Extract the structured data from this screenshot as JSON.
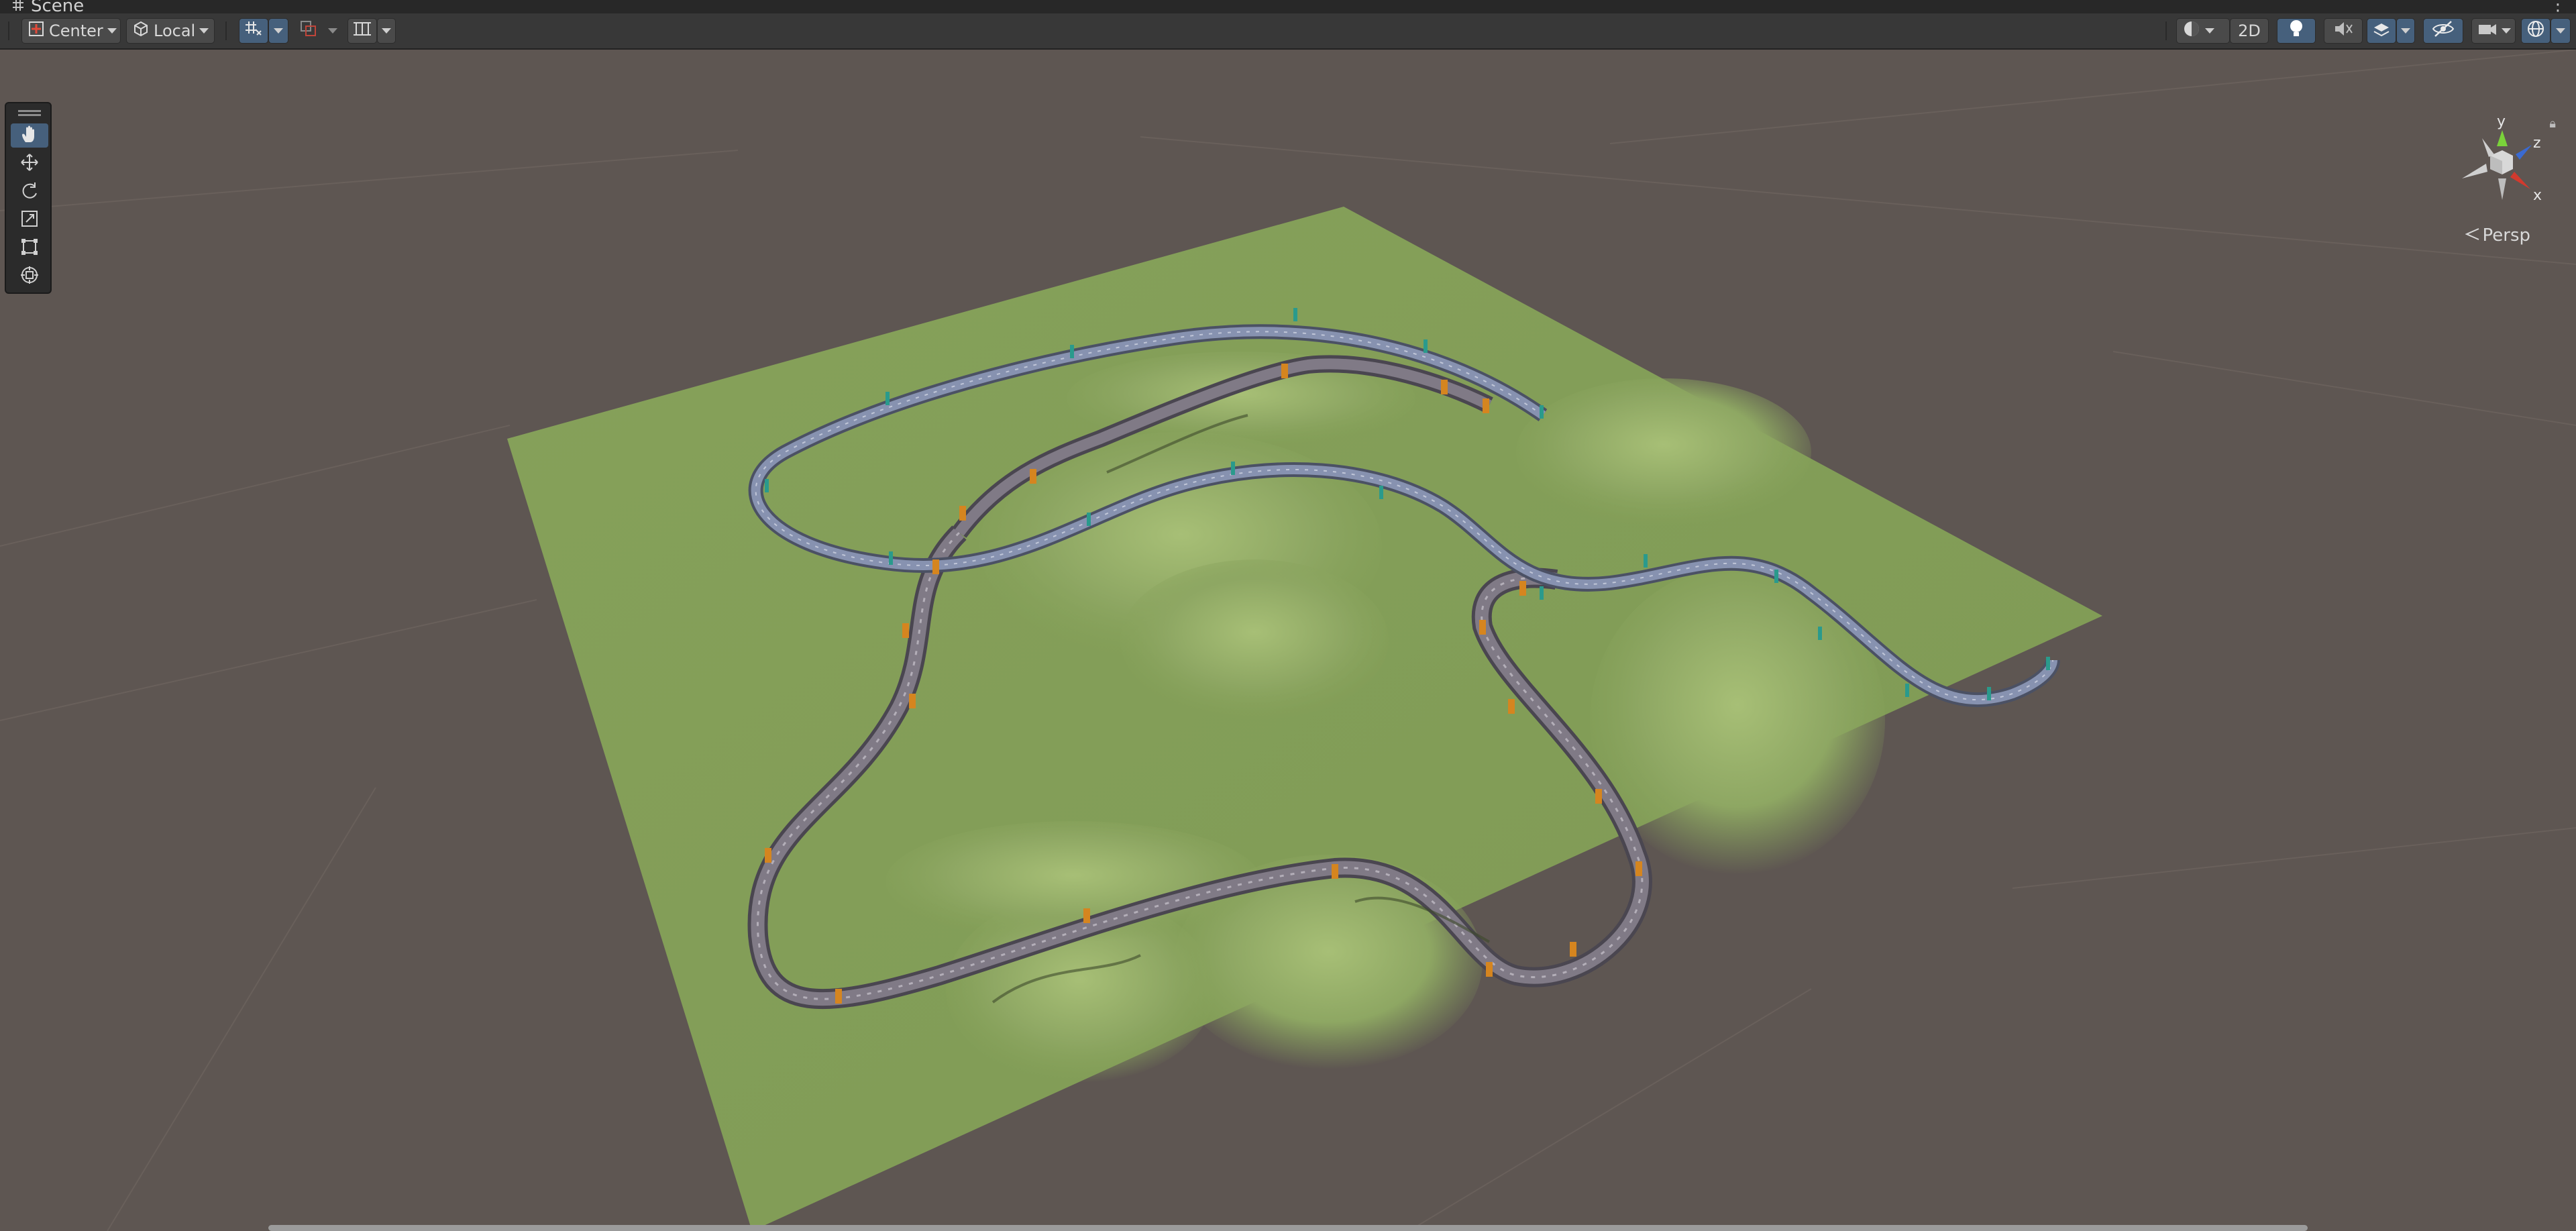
{
  "tab": {
    "title": "Scene",
    "icon": "grid-icon",
    "menu_icon": "kebab-menu-icon"
  },
  "toolbar": {
    "pivot_label": "Center",
    "space_label": "Local",
    "view_2d_label": "2D",
    "left_icons": [
      "grid-snap-icon",
      "increment-snap-icon",
      "grid-visibility-icon"
    ],
    "right_icons": [
      "shading-mode-icon",
      "lighting-icon",
      "audio-icon",
      "effects-icon",
      "hidden-objects-icon",
      "camera-icon",
      "gizmos-icon"
    ]
  },
  "tools": [
    {
      "name": "hand-tool",
      "active": true
    },
    {
      "name": "move-tool",
      "active": false
    },
    {
      "name": "rotate-tool",
      "active": false
    },
    {
      "name": "scale-tool",
      "active": false
    },
    {
      "name": "rect-tool",
      "active": false
    },
    {
      "name": "transform-tool",
      "active": false
    }
  ],
  "gizmo": {
    "axis_x": "x",
    "axis_y": "y",
    "axis_z": "z",
    "projection_label": "Persp"
  },
  "colors": {
    "accent": "#46607c",
    "terrain": "#87a25a",
    "track_main": "#807a86",
    "track_upper": "#8792b0",
    "marker_orange": "#d5851f",
    "marker_teal": "#2a9a8c",
    "axis_x": "#d23a2e",
    "axis_y": "#7ad23a",
    "axis_z": "#3a6ad2"
  }
}
